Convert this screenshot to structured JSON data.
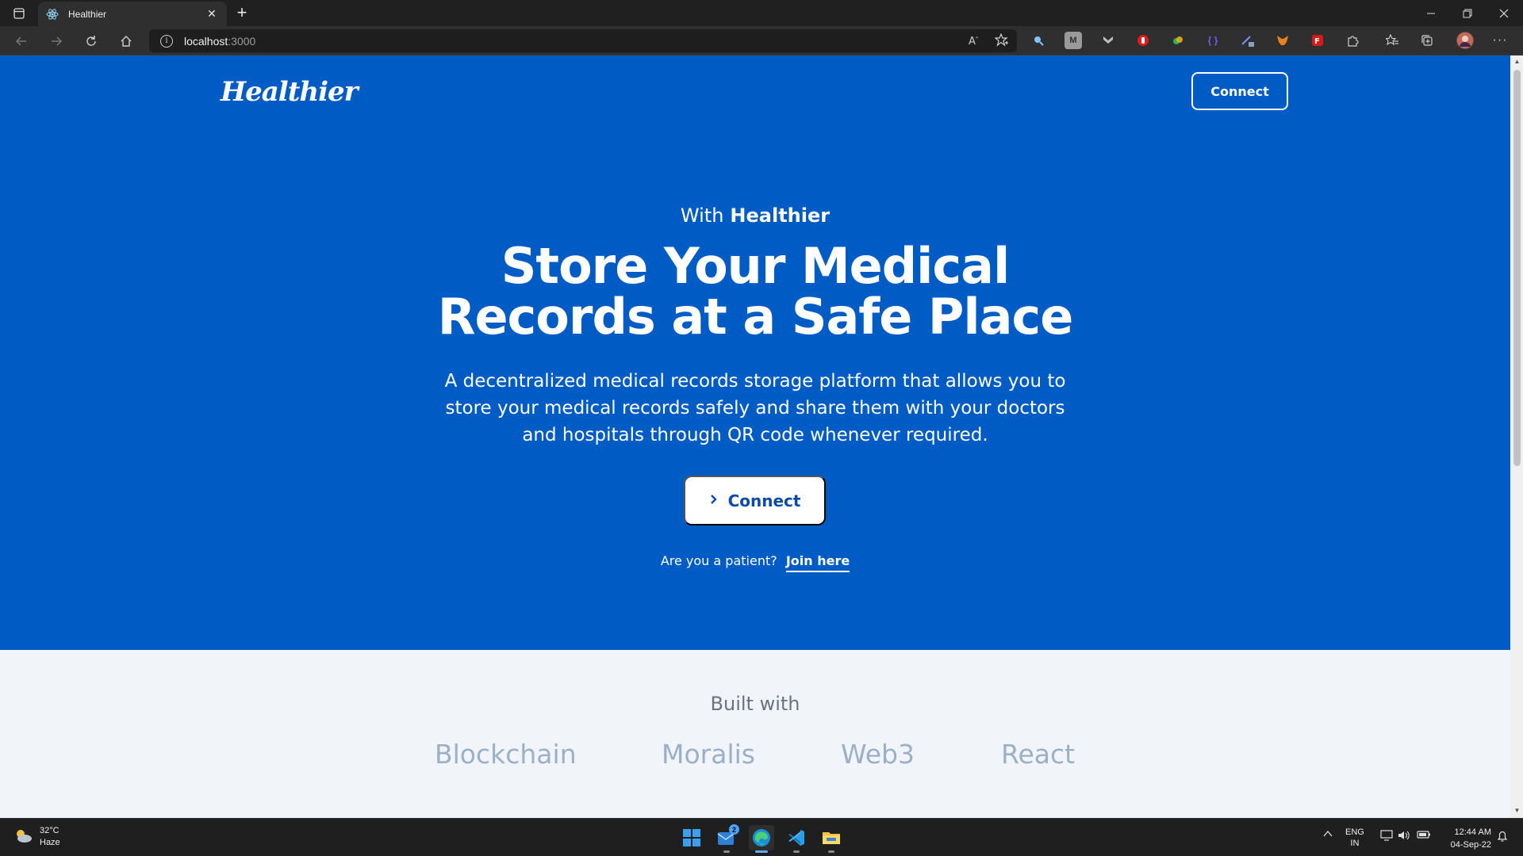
{
  "browser": {
    "tab_title": "Healthier",
    "new_tab_symbol": "+",
    "close_symbol": "✕",
    "url_host": "localhost",
    "url_port": ":3000"
  },
  "page": {
    "logo": "Healthier",
    "header_connect_label": "Connect",
    "eyebrow_prefix": "With",
    "eyebrow_brand": "Healthier",
    "headline_line1": "Store Your Medical",
    "headline_line2": "Records at a Safe Place",
    "description": "A decentralized medical records storage platform that allows you to store your medical records safely and share them with your doctors and hospitals through QR code whenever required.",
    "cta_label": "Connect",
    "patient_prompt": "Are you a patient?",
    "join_label": "Join here",
    "built_with_title": "Built with",
    "technologies": [
      "Blockchain",
      "Moralis",
      "Web3",
      "React"
    ]
  },
  "taskbar": {
    "weather_temp": "32°C",
    "weather_desc": "Haze",
    "mail_badge": "2",
    "lang_line1": "ENG",
    "lang_line2": "IN",
    "time": "12:44 AM",
    "date": "04-Sep-22"
  },
  "colors": {
    "hero_bg": "#005cc5",
    "cta_text": "#0b4aa8",
    "tech_text": "#9bb0c8",
    "page_bg": "#f1f5f9"
  },
  "icons": [
    "tab-actions-icon",
    "react-favicon-icon",
    "back-icon",
    "forward-icon",
    "refresh-icon",
    "home-icon",
    "info-icon",
    "read-aloud-icon",
    "add-favorite-icon",
    "extensions-icon",
    "favorites-icon",
    "collections-icon",
    "profile-avatar-icon",
    "more-icon",
    "windows-start-icon",
    "edge-icon",
    "vscode-icon",
    "file-explorer-icon"
  ]
}
